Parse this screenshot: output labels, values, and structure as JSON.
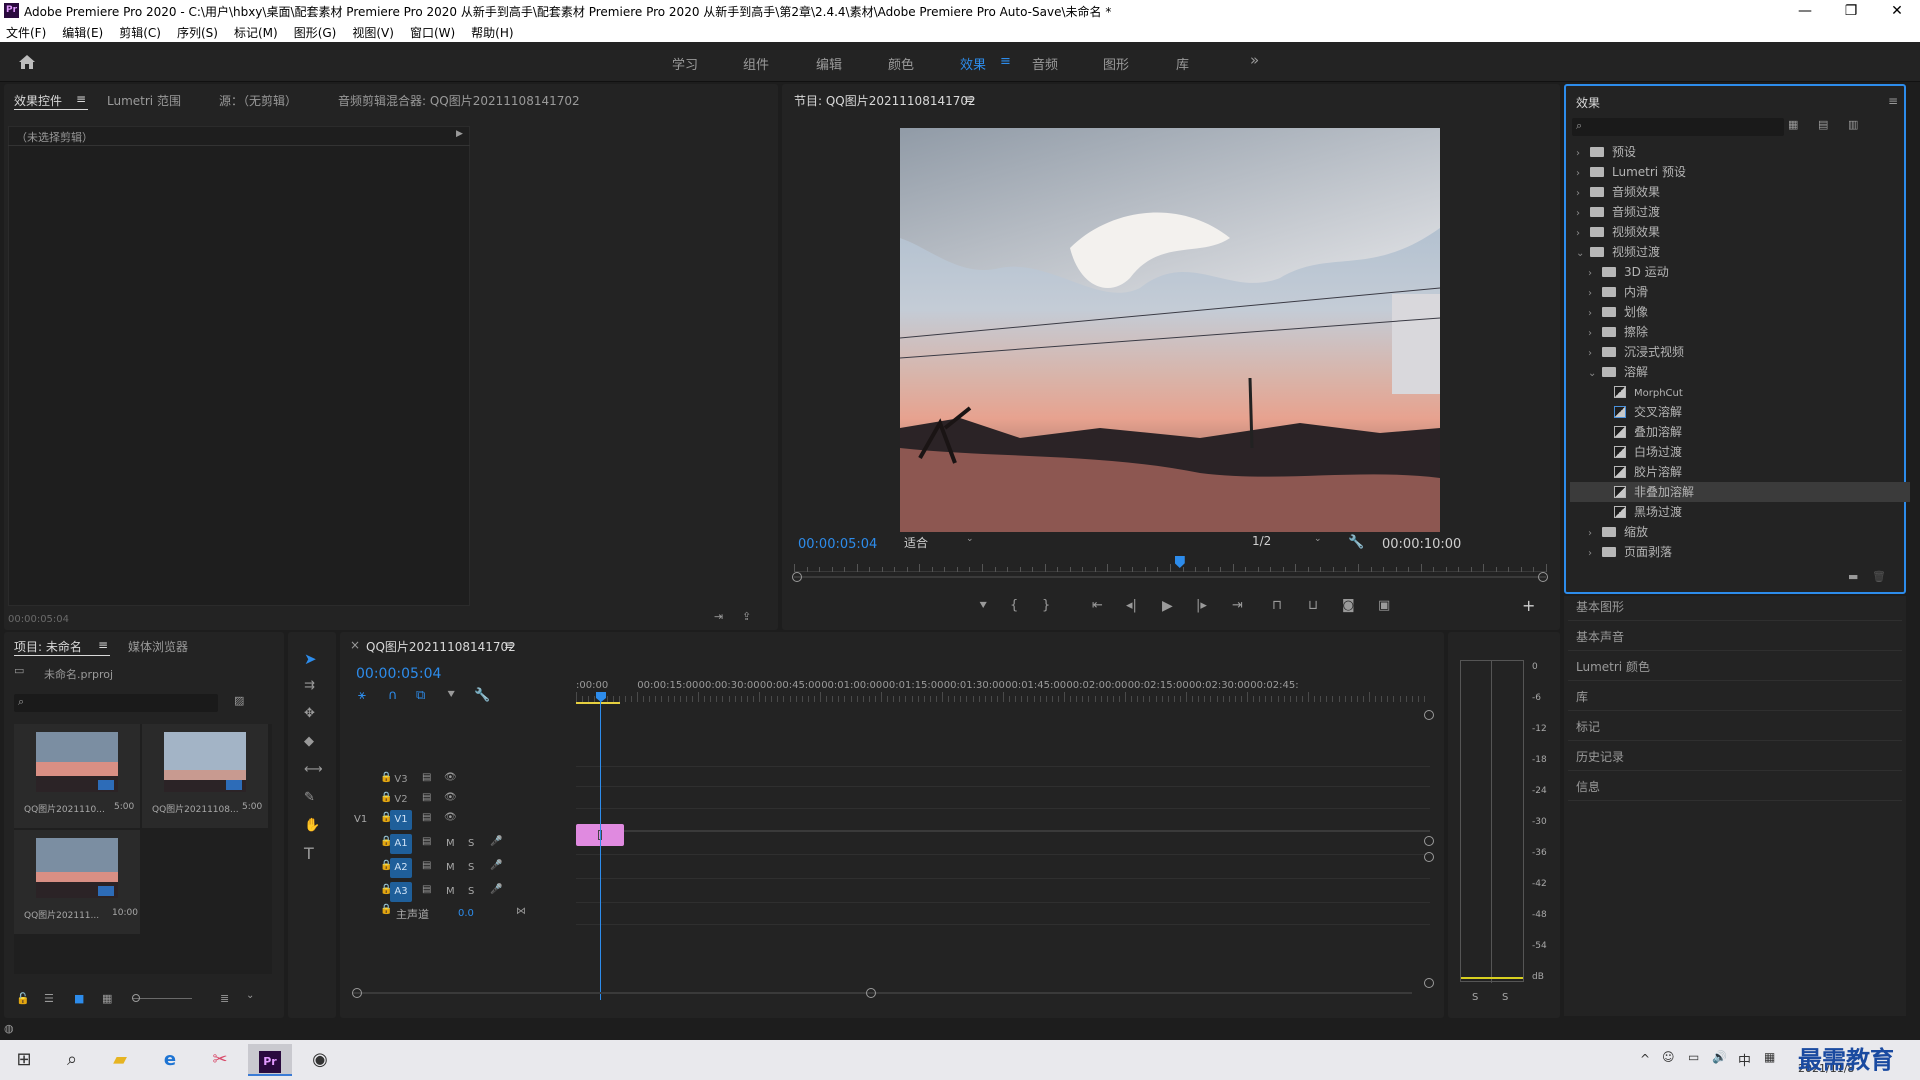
{
  "window": {
    "title": "Adobe Premiere Pro 2020 - C:\\用户\\hbxy\\桌面\\配套素材 Premiere Pro 2020 从新手到高手\\配套素材 Premiere Pro 2020 从新手到高手\\第2章\\2.4.4\\素材\\Adobe Premiere Pro Auto-Save\\未命名 *",
    "logo": "Pr",
    "controls": [
      "—",
      "❐",
      "✕"
    ]
  },
  "menu": [
    "文件(F)",
    "编辑(E)",
    "剪辑(C)",
    "序列(S)",
    "标记(M)",
    "图形(G)",
    "视图(V)",
    "窗口(W)",
    "帮助(H)"
  ],
  "workspaces": {
    "items": [
      "学习",
      "组件",
      "编辑",
      "颜色",
      "效果",
      "音频",
      "图形",
      "库"
    ],
    "active": "效果",
    "more": "»"
  },
  "source_panel": {
    "tabs": [
      "效果控件",
      "Lumetri 范围",
      "源：（无剪辑）",
      "音频剪辑混合器: QQ图片20211108141702"
    ],
    "menu_icon": "≡",
    "no_clip": "（未选择剪辑）",
    "timecode": "00:00:05:04"
  },
  "program_monitor": {
    "title": "节目: QQ图片20211108141702",
    "menu_icon": "≡",
    "current_time": "00:00:05:04",
    "fit": "适合",
    "resolution": "1/2",
    "duration": "00:00:10:00",
    "playhead_fraction": 0.513
  },
  "effects_panel": {
    "title": "效果",
    "menu_icon": "≡",
    "tree": [
      {
        "level": 0,
        "type": "folder-star",
        "label": "预设",
        "open": false
      },
      {
        "level": 0,
        "type": "folder-star",
        "label": "Lumetri 预设",
        "open": false
      },
      {
        "level": 0,
        "type": "folder",
        "label": "音频效果",
        "open": false
      },
      {
        "level": 0,
        "type": "folder",
        "label": "音频过渡",
        "open": false
      },
      {
        "level": 0,
        "type": "folder",
        "label": "视频效果",
        "open": false
      },
      {
        "level": 0,
        "type": "folder",
        "label": "视频过渡",
        "open": true
      },
      {
        "level": 1,
        "type": "folder",
        "label": "3D 运动",
        "open": false
      },
      {
        "level": 1,
        "type": "folder",
        "label": "内滑",
        "open": false
      },
      {
        "level": 1,
        "type": "folder",
        "label": "划像",
        "open": false
      },
      {
        "level": 1,
        "type": "folder",
        "label": "擦除",
        "open": false
      },
      {
        "level": 1,
        "type": "folder",
        "label": "沉浸式视频",
        "open": false
      },
      {
        "level": 1,
        "type": "folder",
        "label": "溶解",
        "open": true
      },
      {
        "level": 2,
        "type": "effect",
        "label": "MorphCut"
      },
      {
        "level": 2,
        "type": "effect-acc",
        "label": "交叉溶解"
      },
      {
        "level": 2,
        "type": "effect",
        "label": "叠加溶解"
      },
      {
        "level": 2,
        "type": "effect",
        "label": "白场过渡"
      },
      {
        "level": 2,
        "type": "effect",
        "label": "胶片溶解"
      },
      {
        "level": 2,
        "type": "effect",
        "label": "非叠加溶解",
        "selected": true
      },
      {
        "level": 2,
        "type": "effect",
        "label": "黑场过渡"
      },
      {
        "level": 1,
        "type": "folder",
        "label": "缩放",
        "open": false
      },
      {
        "level": 1,
        "type": "folder",
        "label": "页面剥落",
        "open": false
      }
    ],
    "collapsed_panels": [
      "基本图形",
      "基本声音",
      "Lumetri 颜色",
      "库",
      "标记",
      "历史记录",
      "信息"
    ]
  },
  "project_panel": {
    "tabs": [
      "项目: 未命名",
      "媒体浏览器"
    ],
    "menu_icon": "≡",
    "file": "未命名.prproj",
    "items": [
      {
        "name": "QQ图片2021110...",
        "duration": "5:00",
        "kind": "sunset"
      },
      {
        "name": "QQ图片20211108...",
        "duration": "5:00",
        "kind": "cloud"
      },
      {
        "name": "QQ图片202111...",
        "duration": "10:00",
        "kind": "sequence"
      }
    ]
  },
  "timeline": {
    "tab": "QQ图片20211108141702",
    "close": "×",
    "menu_icon": "≡",
    "timecode": "00:00:05:04",
    "ruler": [
      ":00:00",
      "00:00:15:00",
      "00:00:30:00",
      "00:00:45:00",
      "00:01:00:00",
      "00:01:15:00",
      "00:01:30:00",
      "00:01:45:00",
      "00:02:00:00",
      "00:02:15:00",
      "00:02:30:00",
      "00:02:45:"
    ],
    "video_tracks": [
      "V3",
      "V2",
      "V1"
    ],
    "source_patch": "V1",
    "audio_tracks": [
      "A1",
      "A2",
      "A3"
    ],
    "mute": "M",
    "solo": "S",
    "master": "主声道",
    "master_value": "0.0",
    "clip_color": "#e08ae0"
  },
  "audio_meter": {
    "scale": [
      "0",
      "-6",
      "-12",
      "-18",
      "-24",
      "-30",
      "-36",
      "-42",
      "-48",
      "-54",
      "dB"
    ],
    "solo": [
      "S",
      "S"
    ]
  },
  "taskbar": {
    "clock_date": "2021/11/8",
    "lang": "中",
    "watermark": "最需教育"
  },
  "colors": {
    "accent": "#2d8ceb",
    "panel": "#232323",
    "background": "#1d1d1d"
  }
}
